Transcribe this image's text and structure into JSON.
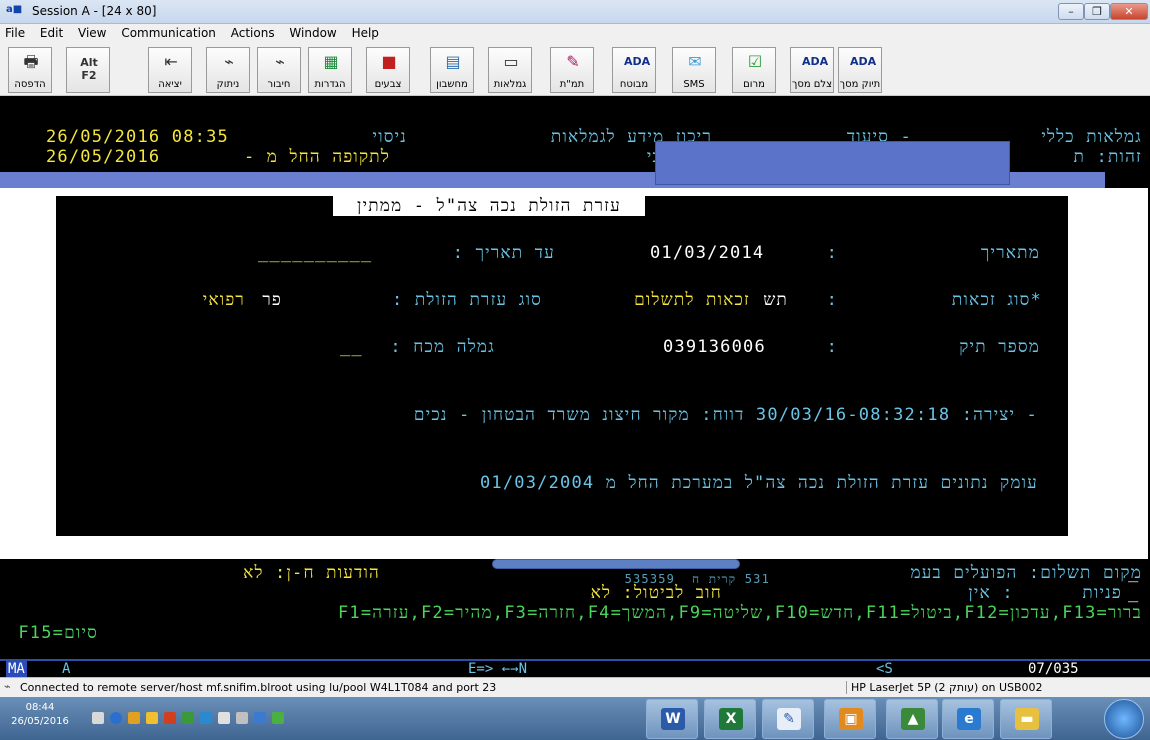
{
  "window": {
    "title": "Session A - [24 x 80]",
    "icon_text": "a■"
  },
  "menu": [
    "File",
    "Edit",
    "View",
    "Communication",
    "Actions",
    "Window",
    "Help"
  ],
  "toolbar": {
    "buttons": [
      {
        "label": "הדפסה",
        "icon": "printer-icon"
      },
      {
        "label": "",
        "icon": "alt-f2-icon",
        "icon_text": "Alt F2"
      },
      {
        "label": "יציאה",
        "icon": "exit-icon"
      },
      {
        "label": "ניתוק",
        "icon": "disconnect-icon"
      },
      {
        "label": "חיבור",
        "icon": "connect-icon"
      },
      {
        "label": "הגדרות",
        "icon": "settings-icon"
      },
      {
        "label": "צבעים",
        "icon": "colors-icon"
      },
      {
        "label": "מחשבון",
        "icon": "calculator-icon"
      },
      {
        "label": "גמלאות",
        "icon": "pensions-icon"
      },
      {
        "label": "תמ\"ת",
        "icon": "tmt-icon"
      },
      {
        "label": "מבוטח",
        "icon": "insured-icon",
        "icon_text": "ADA"
      },
      {
        "label": "SMS",
        "icon": "sms-icon"
      },
      {
        "label": "מרום",
        "icon": "marom-icon"
      },
      {
        "label": "צלם מסך",
        "icon": "screenshot-icon",
        "icon_text": "ADA"
      },
      {
        "label": "תיוק מסך",
        "icon": "file-screen-icon",
        "icon_text": "ADA"
      }
    ]
  },
  "screen": {
    "header": {
      "app_title": "גמלאות כללי",
      "dash_siud": "- סיעוד",
      "center_title": "ריכוז מידע לגמלאות",
      "user_name": "ניסוי",
      "datetime": "26/05/2016 08:35",
      "id_label": "זהות: ת",
      "partial_text": "צבי",
      "period_label": "לתקופה החל מ -",
      "period_date": "26/05/2016"
    },
    "dialog": {
      "title": "עזרת הזולת נכה צה\"ל - ממתין לתוקף",
      "from_date_label": "מתאריך",
      "colon": ":",
      "from_date_value": "01/03/2014",
      "to_date_label": "עד תאריך :",
      "to_date_value": "__________",
      "entitlement_label": "*סוג זכאות",
      "entitlement_code": "תש",
      "entitlement_value": "זכאות לתשלום",
      "help_type_label": "סוג עזרת הזולת :",
      "help_type_code": "פר",
      "help_type_value": "רפואי",
      "file_number_label": "מספר תיק",
      "file_number_value": "039136006",
      "pension_label": "גמלה מכח :",
      "pension_value": "__",
      "creation_line": "- יצירה: 30/03/16-08:32:18 דווח: מקור חיצונ משרד הבטחון - נכים",
      "depth_line": "עומק נתונים עזרת הזולת נכה צה\"ל במערכת החל מ 01/03/2004",
      "side_marks": [
        "_",
        "פ",
        "_",
        "_",
        "_",
        "_",
        "_",
        "_"
      ]
    },
    "footer": {
      "payment_place": "מקום תשלום: הפועלים בעמ",
      "payment_hidden": "531 קרית ח  535359",
      "notices": "הודעות ח-ן: לא",
      "inquiries": "פניות      : אין",
      "cancel_debt": "חוב לביטול: לא",
      "fkeys_line1": "ברור=F13,עדכון=F12,ביטול=F11,חדש=F10,שליטה=F9,המשך=F4,חזרה=F3,מהיר=F2,עזרה=F1",
      "fkeys_line2": "סיום=F15"
    }
  },
  "oia": {
    "ma": "MA",
    "a": "A",
    "arrow": "E=> ←→N",
    "s": "<S",
    "cursor_pos": "07/035"
  },
  "connection": {
    "status": "Connected to remote server/host mf.snifim.blroot using lu/pool W4L1T084 and port 23",
    "printer": "HP LaserJet 5P (עותק 2) on USB002"
  },
  "taskbar": {
    "time": "08:44",
    "date": "26/05/2016"
  },
  "colors": {
    "yellow": "#f5e63b",
    "cyan": "#69c5e8",
    "green": "#4ad65b",
    "blue_band": "#6b7fd0"
  }
}
